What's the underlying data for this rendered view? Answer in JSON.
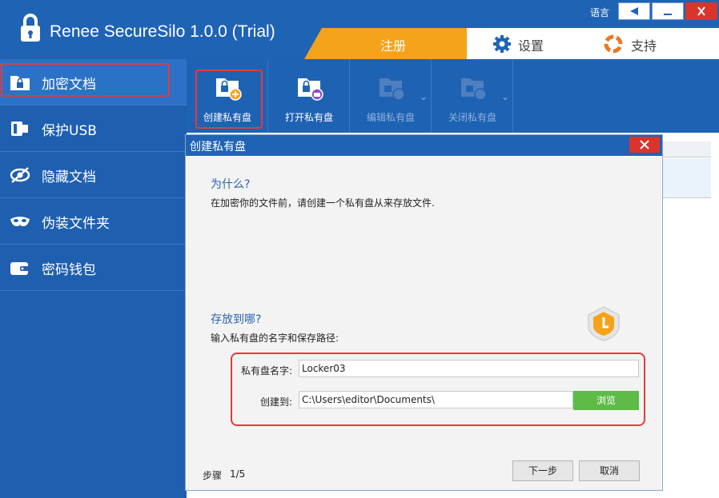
{
  "app": {
    "title": "Renee SecureSilo 1.0.0 (Trial)",
    "language_label": "语言"
  },
  "top_tabs": {
    "register": "注册",
    "settings": "设置",
    "support": "支持"
  },
  "sidebar": {
    "items": [
      {
        "label": "加密文档",
        "icon": "folder-lock-icon",
        "active": true
      },
      {
        "label": "保护USB",
        "icon": "usb-icon",
        "active": false
      },
      {
        "label": "隐藏文档",
        "icon": "eye-slash-icon",
        "active": false
      },
      {
        "label": "伪装文件夹",
        "icon": "mask-icon",
        "active": false
      },
      {
        "label": "密码钱包",
        "icon": "wallet-icon",
        "active": false
      }
    ]
  },
  "toolbar": {
    "create": "创建私有盘",
    "open": "打开私有盘",
    "edit": "编辑私有盘",
    "close": "关闭私有盘"
  },
  "dialog": {
    "title": "创建私有盘",
    "why_title": "为什么?",
    "why_desc": "在加密你的文件前，请创建一个私有盘从来存放文件.",
    "where_title": "存放到哪?",
    "where_desc": "输入私有盘的名字和保存路径:",
    "name_label": "私有盘名字:",
    "name_value": "Locker03",
    "path_label": "创建到:",
    "path_value": "C:\\Users\\editor\\Documents\\",
    "browse": "浏览",
    "step_label": "步骤",
    "step_value": "1/5",
    "next": "下一步",
    "cancel": "取消"
  },
  "colors": {
    "primary": "#1f63b5",
    "accent_orange": "#f5a31a",
    "browse_green": "#5dbb46",
    "highlight_red": "#e23b3b"
  }
}
